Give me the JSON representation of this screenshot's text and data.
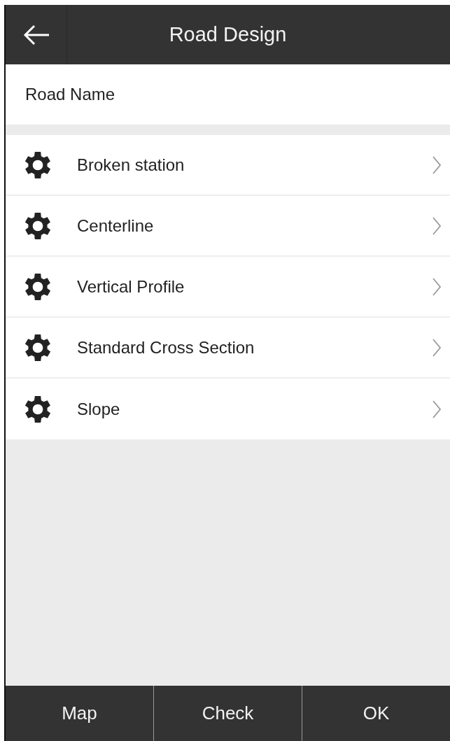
{
  "header": {
    "title": "Road Design"
  },
  "road_name": {
    "label": "Road Name"
  },
  "menu": [
    {
      "label": "Broken station"
    },
    {
      "label": "Centerline"
    },
    {
      "label": "Vertical Profile"
    },
    {
      "label": "Standard Cross Section"
    },
    {
      "label": "Slope"
    }
  ],
  "buttons": [
    "Map",
    "Check",
    "OK"
  ]
}
